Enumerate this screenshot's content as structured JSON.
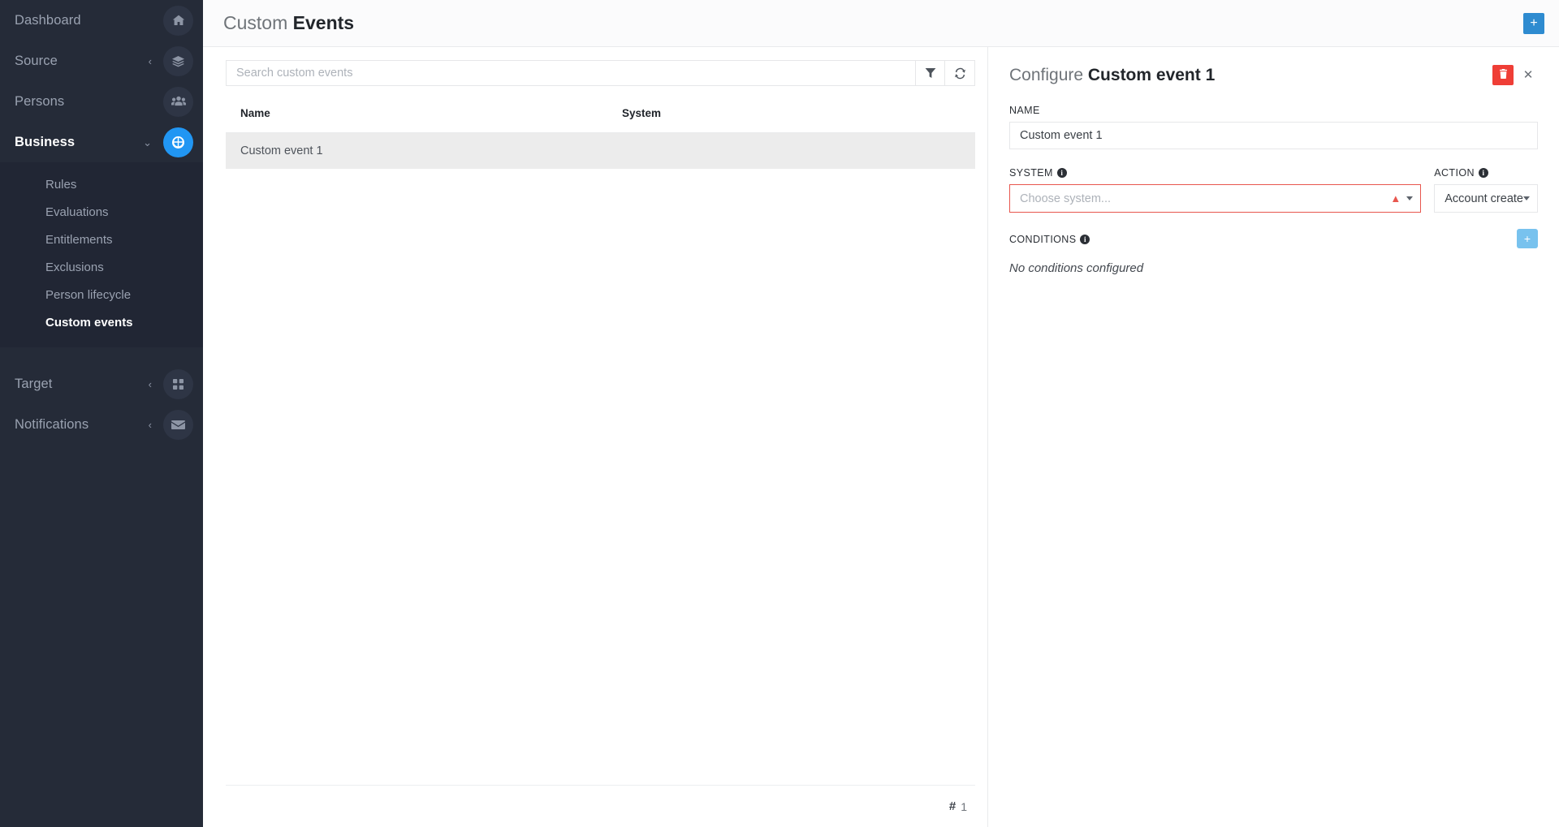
{
  "sidebar": {
    "items": [
      {
        "label": "Dashboard",
        "icon": "home-icon",
        "expandable": false,
        "active": false
      },
      {
        "label": "Source",
        "icon": "layers-icon",
        "expandable": true,
        "chevron": "‹",
        "active": false
      },
      {
        "label": "Persons",
        "icon": "people-icon",
        "expandable": false,
        "active": false
      },
      {
        "label": "Business",
        "icon": "business-icon",
        "expandable": true,
        "chevron": "⌄",
        "active": true
      }
    ],
    "subitems": [
      {
        "label": "Rules",
        "active": false
      },
      {
        "label": "Evaluations",
        "active": false
      },
      {
        "label": "Entitlements",
        "active": false
      },
      {
        "label": "Exclusions",
        "active": false
      },
      {
        "label": "Person lifecycle",
        "active": false
      },
      {
        "label": "Custom events",
        "active": true
      }
    ],
    "bottom_items": [
      {
        "label": "Target",
        "icon": "grid-icon",
        "expandable": true,
        "chevron": "‹"
      },
      {
        "label": "Notifications",
        "icon": "envelope-icon",
        "expandable": true,
        "chevron": "‹"
      }
    ],
    "accent_color": "#2196f3",
    "background_color": "#252b38"
  },
  "topbar": {
    "title_light": "Custom ",
    "title_bold": "Events",
    "add_button_label": "+",
    "add_button_color": "#2e8bd0"
  },
  "list": {
    "search_placeholder": "Search custom events",
    "search_value": "",
    "filter_icon": "filter-icon",
    "refresh_icon": "refresh-icon",
    "columns": [
      "Name",
      "System"
    ],
    "rows": [
      {
        "name": "Custom event 1",
        "system": "",
        "selected": true
      }
    ],
    "footer_count_symbol": "#",
    "footer_count": "1"
  },
  "detail": {
    "title_light": "Configure ",
    "title_bold": "Custom event 1",
    "delete_icon": "trash-icon",
    "close_icon": "close-icon",
    "name_label": "NAME",
    "name_value": "Custom event 1",
    "system_label": "SYSTEM",
    "system_placeholder": "Choose system...",
    "system_value": "",
    "system_invalid": true,
    "system_warning_icon": "warning-icon",
    "action_label": "ACTION",
    "action_value": "Account create",
    "conditions_label": "CONDITIONS",
    "conditions_empty_text": "No conditions configured",
    "add_condition_label": "+",
    "add_condition_color": "#78c2ee",
    "delete_color": "#ef3e36",
    "error_color": "#e8564e"
  }
}
